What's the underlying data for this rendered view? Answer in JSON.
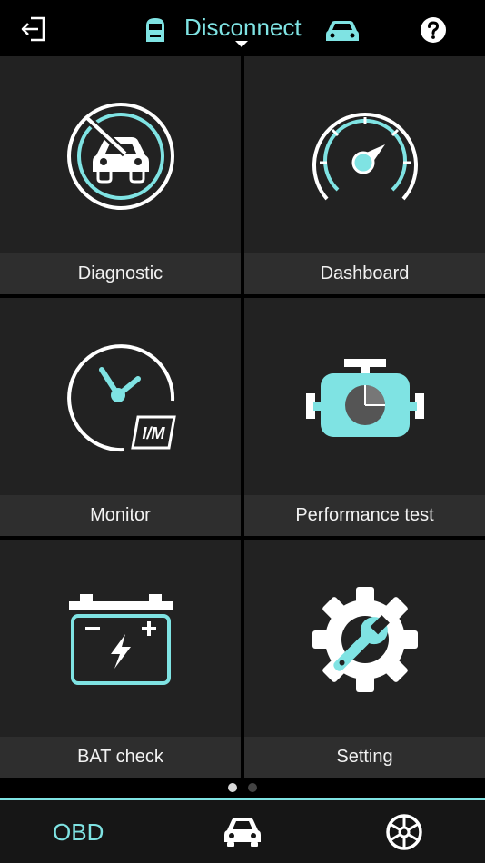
{
  "header": {
    "title": "Disconnect",
    "back_icon": "exit-arrow-icon",
    "connector_icon": "obd-connector-icon",
    "car_icon": "car-front-icon",
    "help_icon": "help-circle-icon"
  },
  "tiles": [
    {
      "label": "Diagnostic",
      "icon": "diagnostic-car-icon"
    },
    {
      "label": "Dashboard",
      "icon": "speedometer-icon"
    },
    {
      "label": "Monitor",
      "icon": "im-monitor-clock-icon"
    },
    {
      "label": "Performance test",
      "icon": "engine-pie-icon"
    },
    {
      "label": "BAT check",
      "icon": "battery-icon"
    },
    {
      "label": "Setting",
      "icon": "gear-wrench-icon"
    }
  ],
  "pager": {
    "current_page": 1,
    "total_pages": 2
  },
  "tabbar": {
    "obd_label": "OBD",
    "car_icon": "car-icon",
    "wheel_icon": "steering-wheel-icon"
  },
  "colors": {
    "accent": "#7fe3e3",
    "tile_bg": "#222222",
    "label_bg": "#2e2e2e",
    "background": "#000000"
  }
}
